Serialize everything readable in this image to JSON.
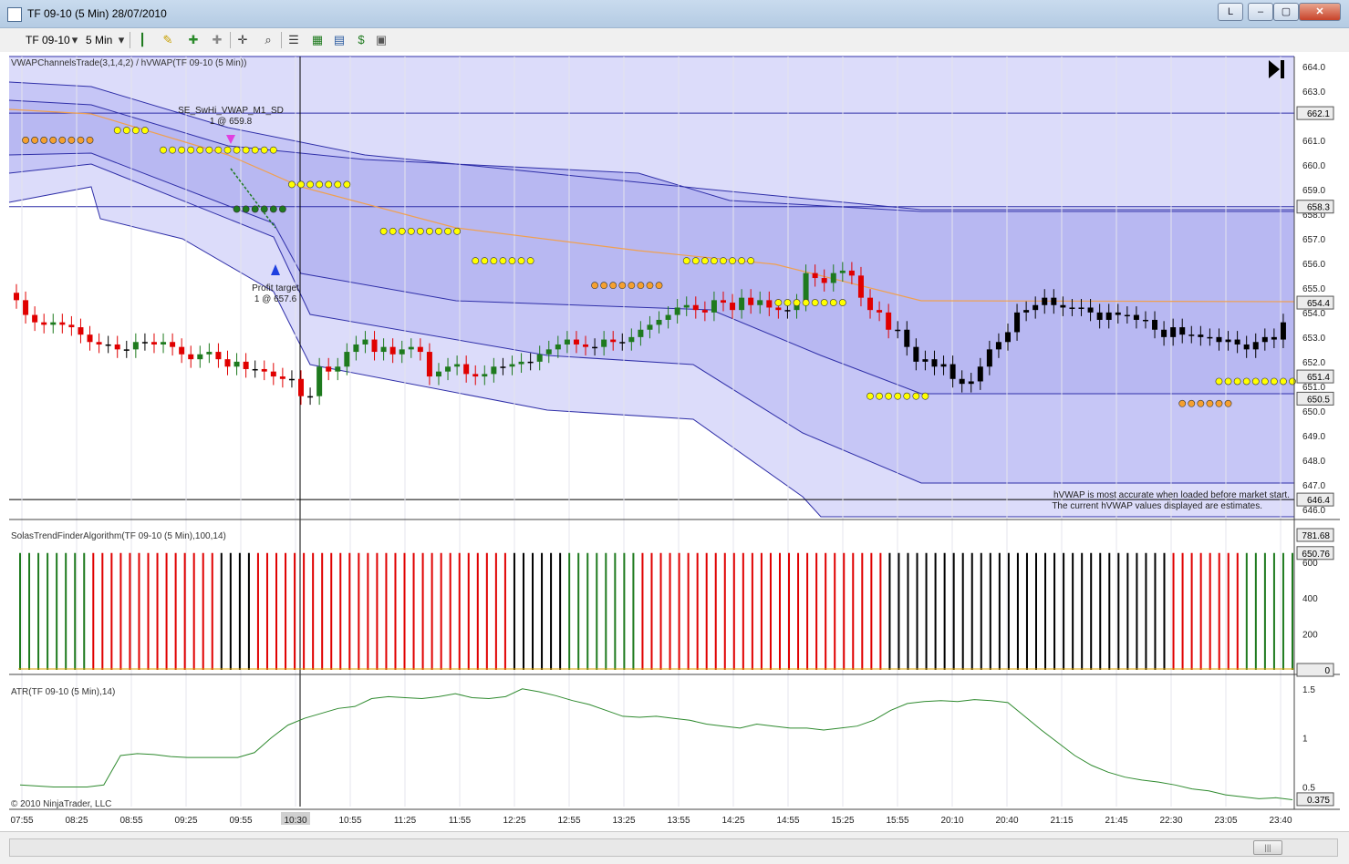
{
  "window": {
    "title": "TF 09-10 (5 Min)  28/07/2010",
    "btn_l": "L",
    "btn_min": "–",
    "btn_max": "▢",
    "btn_close": "✕"
  },
  "toolbar": {
    "instrument": "TF 09-10",
    "interval": "5 Min"
  },
  "colors": {
    "up": "#1e7a1e",
    "down": "#e00000",
    "neutral": "#000000",
    "vwap": "#f0a050",
    "band_line": "#2f2fa8",
    "band_fill_outer": "#dcdcfa",
    "band_fill_mid": "#c6c6f6",
    "band_fill_inner": "#b8b8f2",
    "dot_yellow": "#ffff00",
    "dot_orange": "#f5a030",
    "dot_green": "#1e7a1e",
    "atr": "#2e8a2e"
  },
  "panels": {
    "price": {
      "label": "VWAPChannelsTrade(3,1,4,2) / hVWAP(TF 09-10 (5 Min))",
      "ticks": [
        "664.0",
        "663.0",
        "662.0",
        "661.0",
        "660.0",
        "659.0",
        "658.0",
        "657.0",
        "656.0",
        "655.0",
        "654.0",
        "653.0",
        "652.0",
        "651.0",
        "650.0",
        "649.0",
        "648.0",
        "647.0",
        "646.0"
      ],
      "tags": [
        {
          "text": "662.1",
          "value": 662.1
        },
        {
          "text": "658.3",
          "value": 658.3
        },
        {
          "text": "654.4",
          "value": 654.4
        },
        {
          "text": "651.4",
          "value": 651.4
        },
        {
          "text": "650.5",
          "value": 650.5
        },
        {
          "text": "646.4",
          "value": 646.4
        }
      ],
      "notice_line1": "hVWAP is most accurate when loaded before market start.",
      "notice_line2": "The current hVWAP values displayed are estimates.",
      "entry_label": "SE_SwHi_VWAP_M1_SD",
      "entry_price": "1 @ 659.8",
      "exit_label": "Profit target",
      "exit_price": "1 @ 657.6"
    },
    "trend": {
      "label": "SolasTrendFinderAlgorithm(TF 09-10 (5 Min),100,14)",
      "ticks": [
        "600",
        "400",
        "200"
      ],
      "tag_top": "781.68",
      "tag_mid": "650.76",
      "tag_zero": "0"
    },
    "atr": {
      "label": "ATR(TF 09-10 (5 Min),14)",
      "ticks": [
        "1.5",
        "1",
        "0.5"
      ],
      "tag": "0.375",
      "copyright": "© 2010 NinjaTrader, LLC"
    }
  },
  "x_axis": {
    "labels": [
      "07:55",
      "08:25",
      "08:55",
      "09:25",
      "09:55",
      "10:30",
      "10:55",
      "11:25",
      "11:55",
      "12:25",
      "12:55",
      "13:25",
      "13:55",
      "14:25",
      "14:55",
      "15:25",
      "15:55",
      "20:10",
      "20:40",
      "21:15",
      "21:45",
      "22:30",
      "23:05",
      "23:40"
    ],
    "highlight": "10:30"
  },
  "chart_data": {
    "type": "candlestick",
    "bars": 139,
    "price_ylim": [
      645.7,
      664.4
    ],
    "closes": [
      654.5,
      653.9,
      653.6,
      653.5,
      653.6,
      653.5,
      653.4,
      653.1,
      652.8,
      652.7,
      652.7,
      652.5,
      652.5,
      652.8,
      652.8,
      652.7,
      652.8,
      652.6,
      652.3,
      652.1,
      652.3,
      652.4,
      652.1,
      651.8,
      652.0,
      651.7,
      651.7,
      651.6,
      651.4,
      651.3,
      651.3,
      650.6,
      650.6,
      651.8,
      651.6,
      651.8,
      652.4,
      652.7,
      652.9,
      652.4,
      652.6,
      652.3,
      652.5,
      652.6,
      652.4,
      651.4,
      651.6,
      651.8,
      651.9,
      651.5,
      651.4,
      651.5,
      651.8,
      651.8,
      651.9,
      652.0,
      652.0,
      652.3,
      652.5,
      652.7,
      652.9,
      652.7,
      652.6,
      652.6,
      652.9,
      652.8,
      652.8,
      653.0,
      653.3,
      653.5,
      653.7,
      653.9,
      654.2,
      654.3,
      654.1,
      654.0,
      654.5,
      654.4,
      654.1,
      654.6,
      654.3,
      654.5,
      654.2,
      654.1,
      654.1,
      654.4,
      655.6,
      655.4,
      655.2,
      655.6,
      655.7,
      655.5,
      654.6,
      654.1,
      654.0,
      653.3,
      653.3,
      652.6,
      652.0,
      652.1,
      651.8,
      651.9,
      651.3,
      651.1,
      651.2,
      651.8,
      652.5,
      652.8,
      653.2,
      654.0,
      654.1,
      654.3,
      654.6,
      654.3,
      654.2,
      654.2,
      654.2,
      654.0,
      653.7,
      654.0,
      653.9,
      653.9,
      653.7,
      653.7,
      653.3,
      653.0,
      653.4,
      653.1,
      653.1,
      653.0,
      653.0,
      652.8,
      652.9,
      652.7,
      652.5,
      652.8,
      653.0,
      652.9,
      653.6,
      653.6,
      653.9,
      654.1,
      654.7,
      655.0,
      654.9
    ],
    "trend_ylim": [
      0,
      781.68
    ],
    "trend_last": 650.76,
    "atr_ylim": [
      0.3,
      1.6
    ],
    "atr_last": 0.375
  }
}
